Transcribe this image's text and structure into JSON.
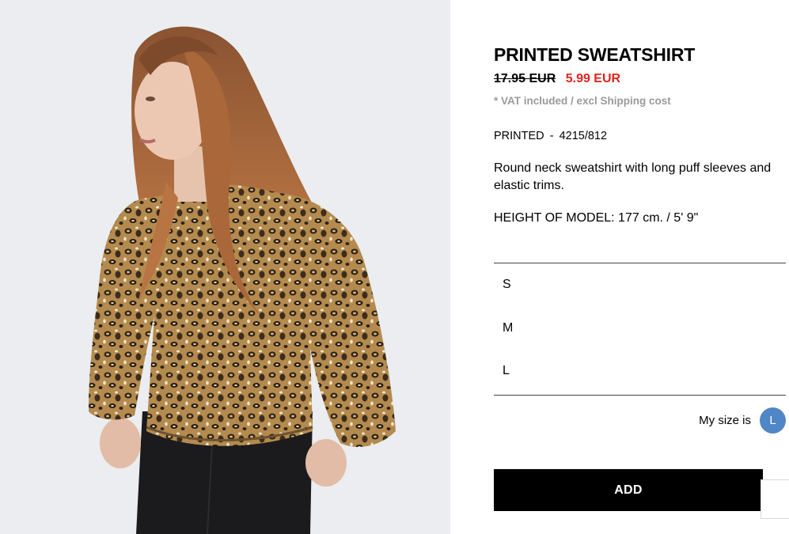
{
  "product": {
    "title": "PRINTED SWEATSHIRT",
    "old_price": "17.95 EUR",
    "new_price": "5.99 EUR",
    "vat_note": "* VAT included / excl Shipping cost",
    "color_name": "PRINTED",
    "separator": "-",
    "reference": "4215/812",
    "description": "Round neck sweatshirt with long puff sleeves and elastic trims.",
    "model_height": "HEIGHT OF MODEL: 177 cm. / 5' 9\""
  },
  "sizes": [
    "S",
    "M",
    "L"
  ],
  "my_size": {
    "label": "My size is",
    "value": "L"
  },
  "add_button": {
    "label": "ADD"
  },
  "colors": {
    "sale_price": "#e5231b",
    "my_size_badge": "#4f86c6",
    "button_bg": "#000000"
  }
}
